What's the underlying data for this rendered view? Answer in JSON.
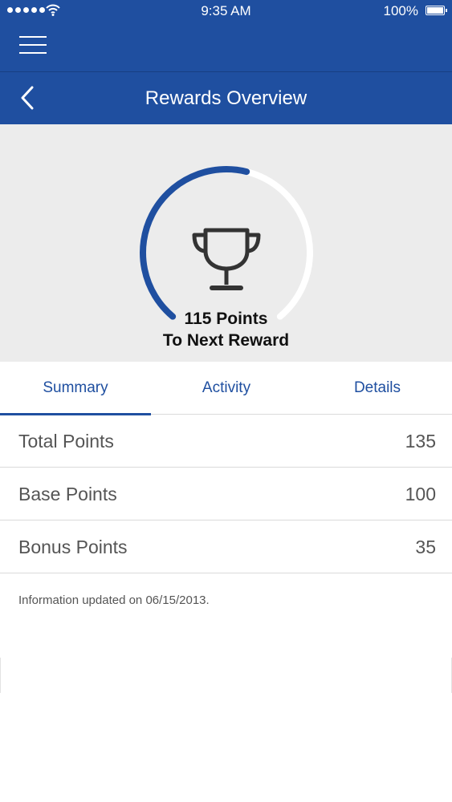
{
  "status_bar": {
    "time": "9:35 AM",
    "battery_percent": "100%",
    "icons": [
      "signal-dots-icon",
      "wifi-icon",
      "battery-icon"
    ]
  },
  "nav": {
    "menu_icon": "hamburger-menu-icon",
    "back_icon": "chevron-left-icon",
    "title": "Rewards Overview"
  },
  "hero": {
    "progress_fraction": 0.55,
    "trophy_icon": "trophy-icon",
    "points_line": "115 Points",
    "reward_line": "To Next Reward"
  },
  "tabs": [
    {
      "label": "Summary",
      "active": true
    },
    {
      "label": "Activity",
      "active": false
    },
    {
      "label": "Details",
      "active": false
    }
  ],
  "points_rows": [
    {
      "label": "Total Points",
      "value": "135"
    },
    {
      "label": "Base Points",
      "value": "100"
    },
    {
      "label": "Bonus Points",
      "value": "35"
    }
  ],
  "note": "Information updated on 06/15/2013.",
  "colors": {
    "brand_blue": "#1f4fa0",
    "hero_bg": "#ececec",
    "ring_track": "#ffffff",
    "text_gray": "#555555"
  }
}
